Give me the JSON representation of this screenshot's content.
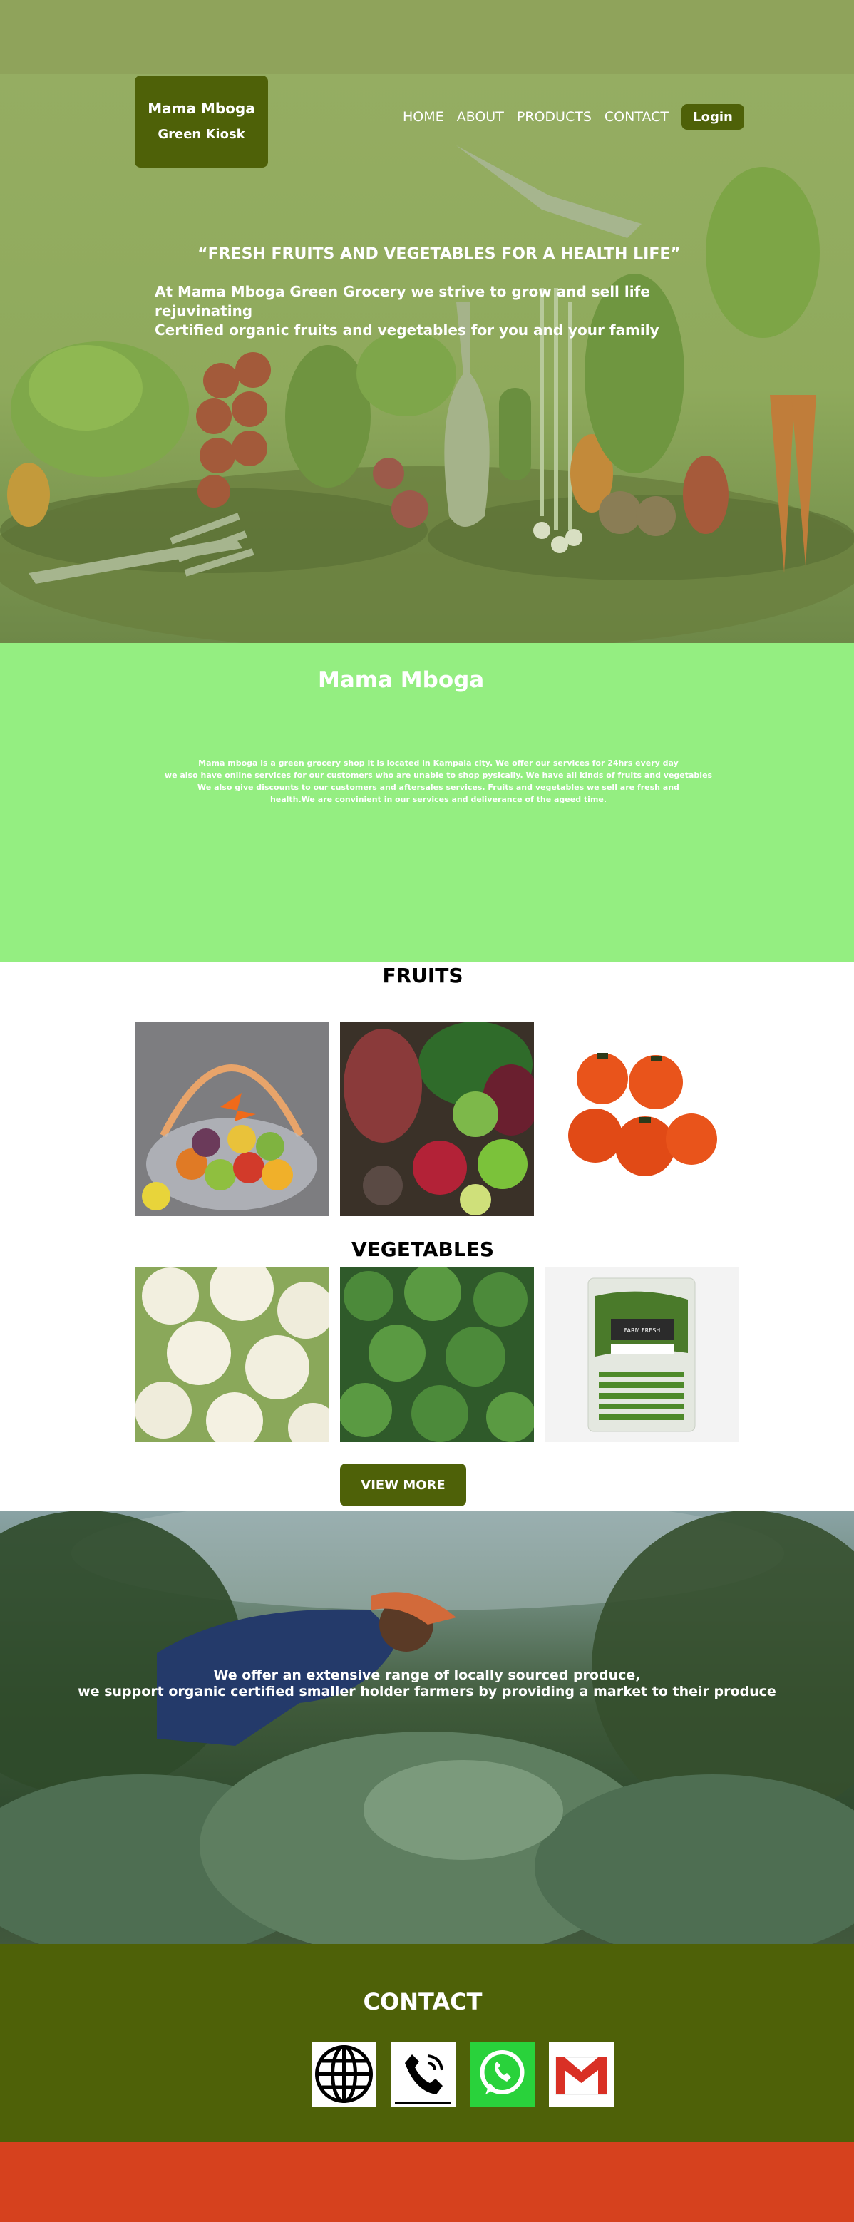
{
  "header": {
    "brand_name": "Mama Mboga",
    "brand_sub": "Green Kiosk",
    "nav": [
      "HOME",
      "ABOUT",
      "PRODUCTS",
      "CONTACT"
    ],
    "login_label": "Login"
  },
  "hero": {
    "tagline": "“FRESH FRUITS AND VEGETABLES FOR A HEALTH LIFE”",
    "intro_line1": "At Mama Mboga Green Grocery we strive to grow and sell life rejuvinating",
    "intro_line2": "Certified organic fruits and vegetables for you and your family"
  },
  "about": {
    "title": "Mama Mboga",
    "line1": "Mama mboga is a green grocery shop it is located in Kampala city. We offer our services for 24hrs every day",
    "line2": "we also have online services for our customers who are unable to shop pysically. We have all kinds of fruits and vegetables",
    "line3": "We also give discounts to our customers and aftersales services. Fruits and vegetables we sell are fresh and",
    "line4": "health.We are convinient in our services and deliverance of the ageed time."
  },
  "products": {
    "fruits_heading": "FRUITS",
    "vegetables_heading": "VEGETABLES",
    "view_more_label": "VIEW MORE",
    "package_label": "FARM FRESH"
  },
  "farm": {
    "line1": "We offer an extensive range of locally sourced produce,",
    "line2": "we support organic certified smaller holder farmers by providing a market to their produce"
  },
  "contact": {
    "title": "CONTACT",
    "icons": [
      "globe-icon",
      "phone-icon",
      "whatsapp-icon",
      "gmail-icon"
    ]
  },
  "colors": {
    "brand_dark_green": "#4e6108",
    "about_green": "#94ee81",
    "hero_overlay": "#8fa35b",
    "footer_orange": "#d6411e"
  }
}
